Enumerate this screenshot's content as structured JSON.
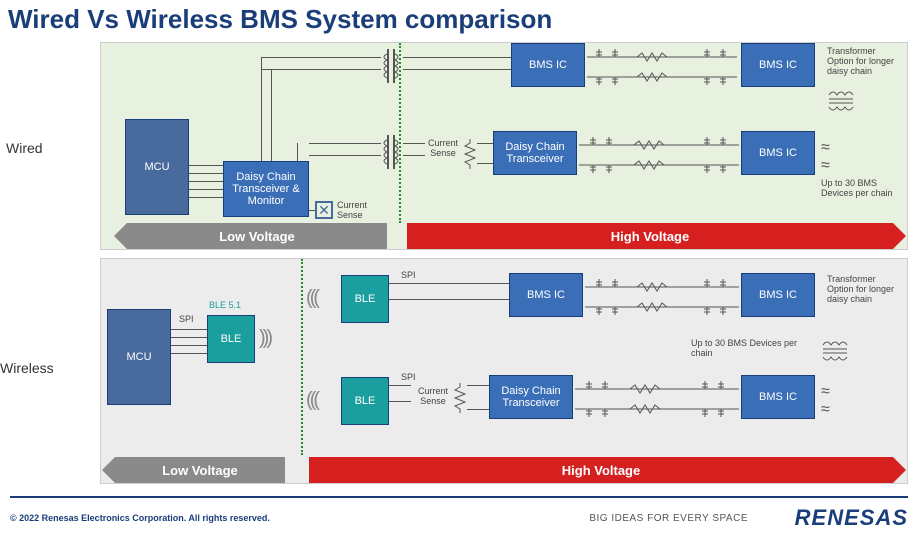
{
  "title": "Wired Vs Wireless BMS System comparison",
  "sections": {
    "wired": "Wired",
    "wireless": "Wireless"
  },
  "blocks": {
    "mcu": "MCU",
    "daisy_monitor": "Daisy Chain Transceiver & Monitor",
    "daisy_trans": "Daisy Chain Transceiver",
    "bms_ic": "BMS IC",
    "ble": "BLE",
    "current_sense": "Current Sense",
    "ble_ver": "BLE 5.1",
    "spi": "SPI"
  },
  "annotations": {
    "transformer_opt": "Transformer Option for longer daisy chain",
    "up_to_30": "Up to 30 BMS Devices per chain"
  },
  "voltage": {
    "low": "Low Voltage",
    "high": "High Voltage"
  },
  "footer": {
    "copyright": "© 2022 Renesas Electronics Corporation. All rights reserved.",
    "tagline": "BIG IDEAS FOR EVERY SPACE",
    "logo": "RENESAS"
  }
}
